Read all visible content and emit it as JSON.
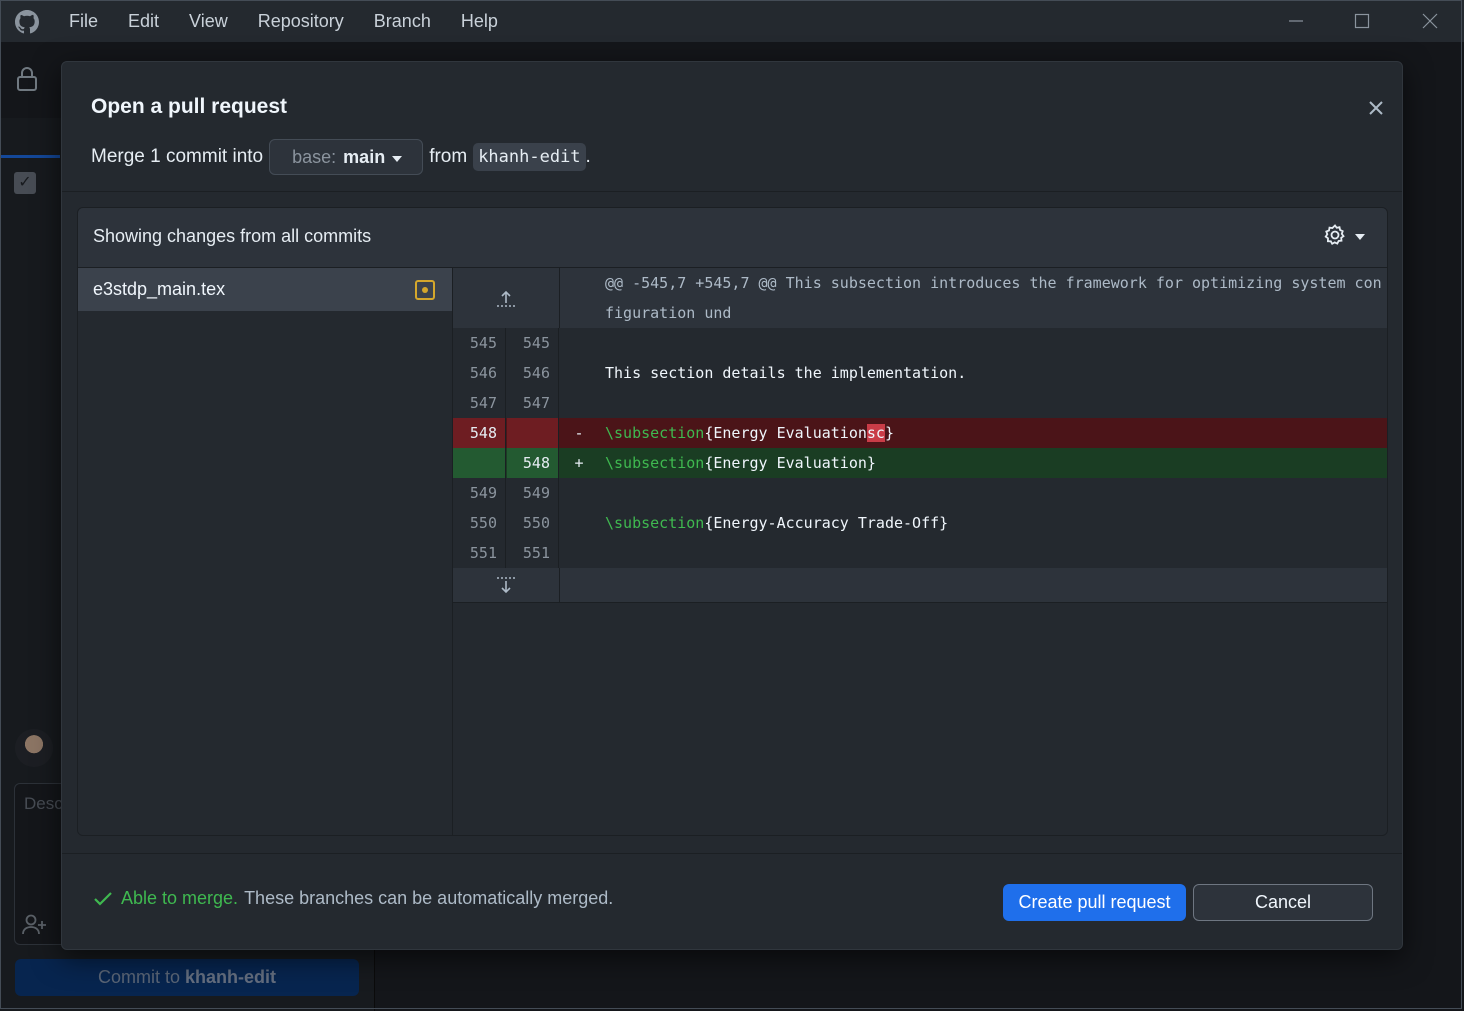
{
  "menu": [
    "File",
    "Edit",
    "View",
    "Repository",
    "Branch",
    "Help"
  ],
  "background": {
    "description_placeholder": "Desc",
    "commit_button_prefix": "Commit to ",
    "commit_button_branch": "khanh-edit"
  },
  "dialog": {
    "title": "Open a pull request",
    "merge_prefix": "Merge 1 commit into",
    "base_label": "base:",
    "base_branch": "main",
    "from_label": "from",
    "head_branch": "khanh-edit",
    "period": "."
  },
  "changes": {
    "heading": "Showing changes from all commits",
    "files": [
      {
        "name": "e3stdp_main.tex",
        "status": "modified"
      }
    ]
  },
  "diff": {
    "hunk_header": "@@ -545,7 +545,7 @@ This subsection introduces the framework for optimizing system configuration und",
    "lines": [
      {
        "old": "545",
        "new": "545",
        "sign": "",
        "type": "context",
        "text": ""
      },
      {
        "old": "546",
        "new": "546",
        "sign": "",
        "type": "context",
        "text": "This section details the implementation."
      },
      {
        "old": "547",
        "new": "547",
        "sign": "",
        "type": "context",
        "text": ""
      },
      {
        "old": "548",
        "new": "",
        "sign": "-",
        "type": "del",
        "cmd": "\\subsection",
        "body": "{Energy Evaluation",
        "hl": "sc",
        "tail": "}"
      },
      {
        "old": "",
        "new": "548",
        "sign": "+",
        "type": "add",
        "cmd": "\\subsection",
        "body": "{Energy Evaluation}",
        "hl": "",
        "tail": ""
      },
      {
        "old": "549",
        "new": "549",
        "sign": "",
        "type": "context",
        "text": ""
      },
      {
        "old": "550",
        "new": "550",
        "sign": "",
        "type": "cmd",
        "cmd": "\\subsection",
        "body": "{Energy-Accuracy Trade-Off}"
      },
      {
        "old": "551",
        "new": "551",
        "sign": "",
        "type": "context",
        "text": ""
      }
    ]
  },
  "footer": {
    "status_strong": "Able to merge.",
    "status_text": "These branches can be automatically merged.",
    "create_label": "Create pull request",
    "cancel_label": "Cancel"
  },
  "colors": {
    "accent": "#1f6feb",
    "success": "#3fb950",
    "deleted_bg": "#4b1418",
    "added_bg": "#1a3d23",
    "modified_icon": "#d4a72c"
  },
  "icons": [
    "github-logo-icon",
    "lock-icon",
    "close-icon",
    "gear-icon",
    "chevron-down-icon",
    "expand-up-icon",
    "expand-down-icon",
    "file-modified-icon",
    "check-icon",
    "add-person-icon"
  ]
}
